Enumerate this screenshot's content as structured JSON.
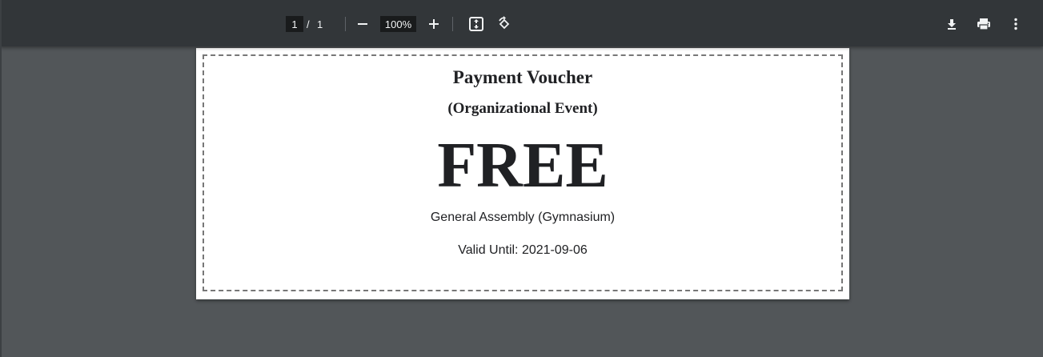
{
  "toolbar": {
    "page_current": "1",
    "page_separator": "/",
    "page_total": "1",
    "zoom_value": "100%",
    "icons": {
      "zoom_out": "minus-icon",
      "zoom_in": "plus-icon",
      "fit": "fit-to-page-icon",
      "rotate": "rotate-counterclockwise-icon",
      "download": "download-icon",
      "print": "print-icon",
      "more": "more-vertical-icon"
    }
  },
  "document": {
    "title": "Payment Voucher",
    "subtitle": "(Organizational Event)",
    "amount": "FREE",
    "location": "General Assembly (Gymnasium)",
    "valid_until": "Valid Until: 2021-09-06"
  },
  "colors": {
    "toolbar_bg": "#323639",
    "viewer_bg": "#525659",
    "page_bg": "#ffffff",
    "text": "#202124"
  }
}
